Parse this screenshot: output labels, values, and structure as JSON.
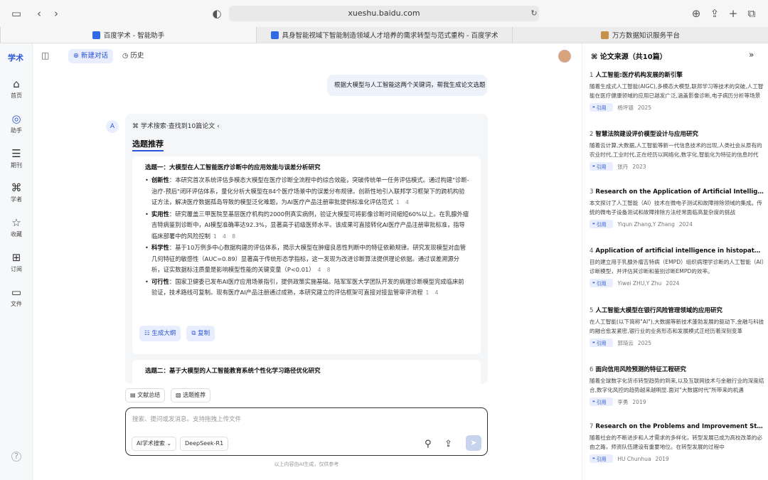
{
  "browser": {
    "url": "xueshu.baidu.com",
    "tabs": [
      "百度学术 - 智能助手",
      "具身智能视域下智能制造领域人才培养的需求转型与范式重构 - 百度学术",
      "万方数据知识服务平台"
    ]
  },
  "rail": {
    "logo": "学术",
    "items": [
      "首页",
      "助手",
      "期刊",
      "学者",
      "收藏",
      "订阅",
      "文件"
    ]
  },
  "topbar": {
    "new_chat": "新建对话",
    "history": "历史"
  },
  "user_message": "根据大模型与人工智能这两个关键词，帮我生成论文选题",
  "answer": {
    "search_status": "学术搜索·查找到10篇论文",
    "section_title": "选题推荐",
    "topic1": {
      "title": "选题一：大模型在人工智能医疗诊断中的应用效能与误差分析研究",
      "points": [
        {
          "label": "创新性",
          "text": "：本研究首次系统评估多模态大模型在医疗诊断全流程中的综合效能，突破传统单一任务评估模式。通过构建\"诊断-治疗-预后\"闭环评估体系，量化分析大模型在84个医疗场景中的误差分布规律。创新性地引入联邦学习框架下的跨机构验证方法，解决医疗数据孤岛导致的模型泛化难题，为AI医疗产品注册审批提供标准化评估范式",
          "cites": "1 4"
        },
        {
          "label": "实用性",
          "text": "：研究覆盖三甲医院至基层医疗机构的2000例真实病例，验证大模型可将影像诊断时间缩短60%以上。在乳腺外瘤吉特病鉴别诊断中，AI模型准确率达92.3%，显著高于初级医师水平。该成果可直接转化AI医疗产品注册审批标准，指导临床部署中的风险控制",
          "cites": "1 4 8"
        },
        {
          "label": "科学性",
          "text": "：基于10万例多中心数据构建的评估体系，揭示大模型在肿瘤良恶性判断中的特征依赖规律。研究发现模型对血管几何特征的敏感性（AUC=0.89）显著高于传统形态学指标，这一发现为改进诊断算法提供理论依据。通过误差溯源分析，证实数据标注质量是影响模型性能的关键变量（P<0.01）",
          "cites": "4 8"
        },
        {
          "label": "可行性",
          "text": "：国家卫健委已发布AI医疗应用场景指引，提供政策实施基础。陆军军医大学团队开发的病理诊断模型完成临床前验证，技术路线可复制。现有医疗AI产品注册通过成熟，本研究建立的评估框架可直接对接监管审评流程",
          "cites": "1 4"
        }
      ]
    },
    "actions": {
      "outline": "生成大纲",
      "copy": "复制"
    },
    "topic2_title": "选题二：基于大模型的人工智能教育系统个性化学习路径优化研究"
  },
  "quick": {
    "summary": "文献总结",
    "topics": "选题推荐"
  },
  "input": {
    "placeholder": "搜索、提问或发消息。支持拖拽上传文件",
    "mode": "AI学术搜索",
    "model": "DeepSeek-R1"
  },
  "disclaimer": "以上内容由AI生成，仅供参考",
  "sources": {
    "header": "论文来源（共10篇）",
    "cite_label": "引用",
    "items": [
      {
        "num": "1",
        "title": "人工智能:医疗机构发展的新引擎",
        "excerpt": "随着生成式人工智能(AIGC),多模态大模型,联邦学习等技术的突破,人工智能在医疗健康领域的应用已越发广泛,涵盖影像诊断,电子病历分析等场景",
        "author": "杨坪银",
        "year": "2025"
      },
      {
        "num": "2",
        "title": "智慧法院建设评价模型设计与应用研究",
        "excerpt": "随着云计算,大数据,人工智能等新一代信息技术的出现,人类社会从原有的农业时代,工业时代,正在经历以网络化,数字化,智能化为特征的信息时代",
        "author": "张丹",
        "year": "2023"
      },
      {
        "num": "3",
        "title": "Research on the Application of Artificial Intelligence",
        "excerpt": "本文探讨了人工智能（AI）技术在微电子测试和故障排除领域的集成。传统的微电子设备测试和故障排除方法经常面临高复杂度的挑战",
        "author": "Yiqun Zhang,Y Zhang",
        "year": "2024"
      },
      {
        "num": "4",
        "title": "Application of artificial intelligence in histopathology",
        "excerpt": "目的建立用于乳腺外瘤吉特病（EMPD）组织病理学诊断的人工智能（AI）诊断模型，并评估其诊断和鉴别诊断EMPD的效率。",
        "author": "Yiwei ZHU,Y Zhu",
        "year": "2024"
      },
      {
        "num": "5",
        "title": "人工智能大模型在银行风险管理领域的应用研究",
        "excerpt": "在人工智能(以下简称\"AI\"),大数据等新技术蓬勃发展的驱动下,金融与科技的融合愈发紧密,银行业的业务形态和发展模式正经历着深刻变革",
        "author": "郭琦云",
        "year": "2025"
      },
      {
        "num": "6",
        "title": "面向信用风险预测的特征工程研究",
        "excerpt": "随着全球数字化货币转型趋势的到来,以及互联网技术与金融行业的深度结合,数字化风控的趋势越来越明显.面对\"大数据时代\"所带来的机遇",
        "author": "李勇",
        "year": "2019"
      },
      {
        "num": "7",
        "title": "Research on the Problems and Improvement Strategies",
        "excerpt": "随着社会的不断进步和人才需求的多样化，转型发展已成为高校改革的必由之路，师资队伍建设有重要地位。在转型发展的过程中",
        "author": "HU Chunhua",
        "year": "2019"
      }
    ]
  }
}
